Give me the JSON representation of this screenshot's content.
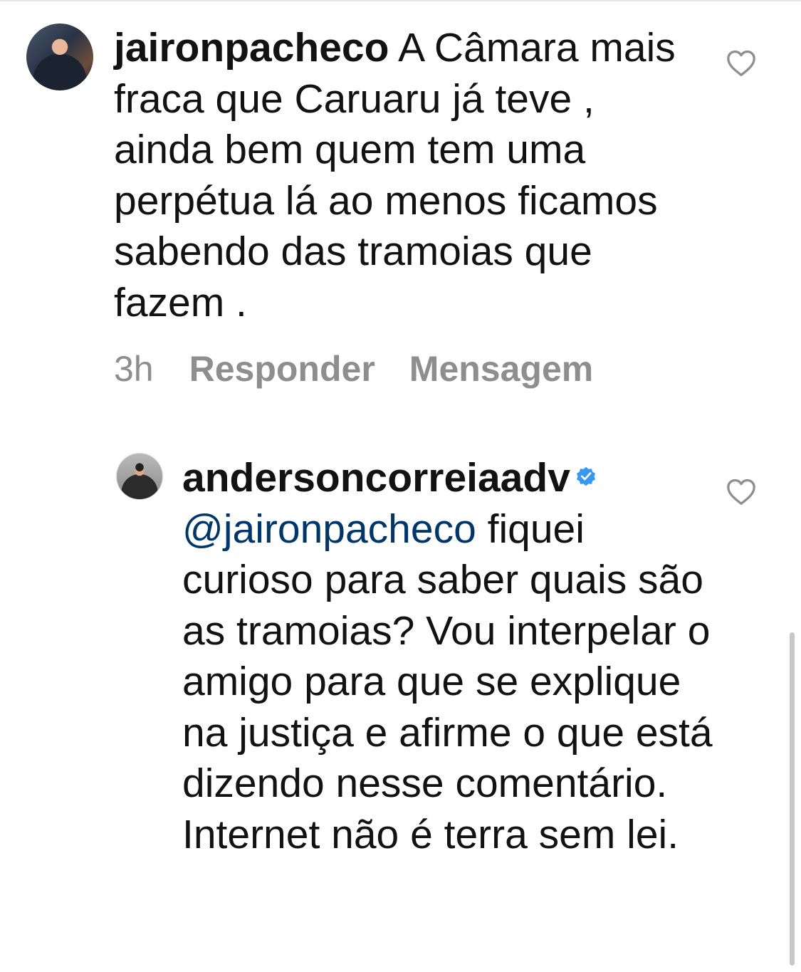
{
  "comments": [
    {
      "username": "jaironpacheco",
      "avatar_icon": "user-avatar",
      "text": "A Câmara mais fraca que Caruaru já teve , ainda bem quem tem uma perpétua lá ao menos ficamos sabendo das tramoias que fazem .",
      "time": "3h",
      "reply_label": "Responder",
      "message_label": "Mensagem",
      "like_icon": "heart-outline-icon"
    }
  ],
  "reply": {
    "username": "andersoncorreiaadv",
    "verified": true,
    "verified_icon": "verified-badge-icon",
    "avatar_icon": "user-avatar",
    "mention": "@jaironpacheco",
    "text": "fiquei curioso para saber quais são as tramoias? Vou interpelar o amigo para que se explique na justiça e afirme o que está dizendo nesse comentário. Internet não é terra sem lei.",
    "like_icon": "heart-outline-icon"
  },
  "colors": {
    "text": "#121212",
    "secondary": "#8e8e8e",
    "mention": "#00376b",
    "verified": "#3897f0"
  }
}
